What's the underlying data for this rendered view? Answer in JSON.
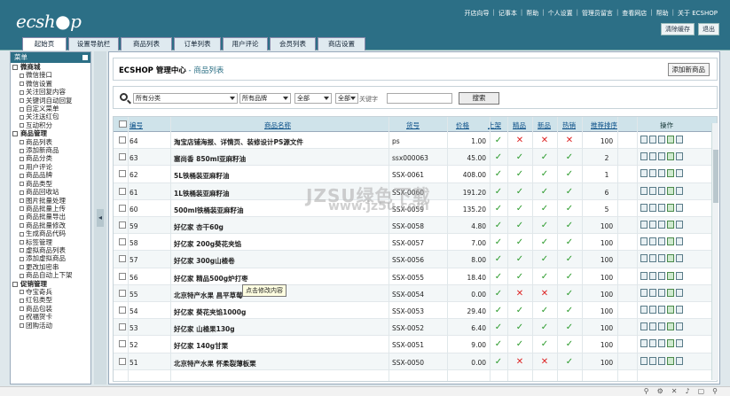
{
  "logo": "ecsh●p",
  "top_links": [
    "开店向导",
    "记事本",
    "帮助",
    "个人设置",
    "管理员留言",
    "查看网店",
    "帮助",
    "关于 ECSHOP"
  ],
  "top_buttons": [
    "清除缓存",
    "退出"
  ],
  "tabs": [
    "起始页",
    "设置导航栏",
    "商品列表",
    "订单列表",
    "用户评论",
    "会员列表",
    "商店设置"
  ],
  "sidebar": {
    "title": "菜单",
    "groups": [
      {
        "label": "微商城",
        "items": [
          "微信接口",
          "微信设置",
          "关注回复内容",
          "关键词自动回复",
          "自定义菜单",
          "关注送红包",
          "互动积分"
        ]
      },
      {
        "label": "商品管理",
        "items": [
          "商品列表",
          "添加新商品",
          "商品分类",
          "用户评论",
          "商品品牌",
          "商品类型",
          "商品回收站",
          "图片批量处理",
          "商品批量上传",
          "商品批量导出",
          "商品批量修改",
          "生成商品代码",
          "标签管理",
          "虚拟商品列表",
          "添加虚拟商品",
          "更改加密串",
          "商品自动上下架"
        ]
      },
      {
        "label": "促销管理",
        "items": [
          "夺宝奇兵",
          "红包类型",
          "商品包装",
          "祝福贺卡",
          "团购活动"
        ]
      }
    ]
  },
  "page_title": "ECSHOP 管理中心",
  "page_subtitle": " - 商品列表",
  "add_button": "添加新商品",
  "search": {
    "category": "所有分类",
    "brand": "所有品牌",
    "status1": "全部",
    "status2": "全部",
    "keyword_label": "关键字",
    "keyword_value": "",
    "button": "搜索"
  },
  "table": {
    "headers": {
      "id": "编号",
      "name": "商品名称",
      "sku": "货号",
      "price": "价格",
      "on_sale": "上架",
      "best": "精品",
      "new": "新品",
      "hot": "热销",
      "sort": "推荐排序",
      "ops": "操作"
    },
    "rows": [
      {
        "id": "64",
        "name": "淘宝店铺海报、详情页、装修设计PS源文件",
        "sku": "ps",
        "price": "1.00",
        "on_sale": true,
        "best": false,
        "new": false,
        "hot": false,
        "sort": "100"
      },
      {
        "id": "63",
        "name": "塞尚香 850ml亚麻籽油",
        "sku": "ssx000063",
        "price": "45.00",
        "on_sale": true,
        "best": true,
        "new": true,
        "hot": true,
        "sort": "2"
      },
      {
        "id": "62",
        "name": "5L铁桶装亚麻籽油",
        "sku": "SSX-0061",
        "price": "408.00",
        "on_sale": true,
        "best": true,
        "new": true,
        "hot": true,
        "sort": "1"
      },
      {
        "id": "61",
        "name": "1L铁桶装亚麻籽油",
        "sku": "SSX-0060",
        "price": "191.20",
        "on_sale": true,
        "best": true,
        "new": true,
        "hot": true,
        "sort": "6"
      },
      {
        "id": "60",
        "name": "500ml铁桶装亚麻籽油",
        "sku": "SSX-0059",
        "price": "135.20",
        "on_sale": true,
        "best": true,
        "new": true,
        "hot": true,
        "sort": "5"
      },
      {
        "id": "59",
        "name": "好亿家 杏干60g",
        "sku": "SSX-0058",
        "price": "4.80",
        "on_sale": true,
        "best": true,
        "new": true,
        "hot": true,
        "sort": "100"
      },
      {
        "id": "58",
        "name": "好亿家 200g葵花夹馅",
        "sku": "SSX-0057",
        "price": "7.00",
        "on_sale": true,
        "best": true,
        "new": true,
        "hot": true,
        "sort": "100"
      },
      {
        "id": "57",
        "name": "好亿家 300g山楂卷",
        "sku": "SSX-0056",
        "price": "8.00",
        "on_sale": true,
        "best": true,
        "new": true,
        "hot": true,
        "sort": "100"
      },
      {
        "id": "56",
        "name": "好亿家 精品500g炉打枣",
        "sku": "SSX-0055",
        "price": "18.40",
        "on_sale": true,
        "best": true,
        "new": true,
        "hot": true,
        "sort": "100"
      },
      {
        "id": "55",
        "name": "北京特产水果 昌平草莓",
        "sku": "SSX-0054",
        "price": "0.00",
        "on_sale": true,
        "best": false,
        "new": false,
        "hot": true,
        "sort": "100"
      },
      {
        "id": "54",
        "name": "好亿家 葵花夹馅1000g",
        "sku": "SSX-0053",
        "price": "29.40",
        "on_sale": true,
        "best": true,
        "new": true,
        "hot": true,
        "sort": "100"
      },
      {
        "id": "53",
        "name": "好亿家 山楂果130g",
        "sku": "SSX-0052",
        "price": "6.40",
        "on_sale": true,
        "best": true,
        "new": true,
        "hot": true,
        "sort": "100"
      },
      {
        "id": "52",
        "name": "好亿家 140g甘栗",
        "sku": "SSX-0051",
        "price": "9.00",
        "on_sale": true,
        "best": true,
        "new": true,
        "hot": true,
        "sort": "100"
      },
      {
        "id": "51",
        "name": "北京特产水果 怀柔裂薄板栗",
        "sku": "SSX-0050",
        "price": "0.00",
        "on_sale": true,
        "best": false,
        "new": false,
        "hot": true,
        "sort": "100"
      }
    ]
  },
  "tooltip": "点击修改内容",
  "watermark": "JZSU绿色下载",
  "watermark_url": "www.jz5u.com",
  "colors": {
    "header_bg": "#2c6f86",
    "ok": "#2a9a2a",
    "no": "#d22"
  }
}
